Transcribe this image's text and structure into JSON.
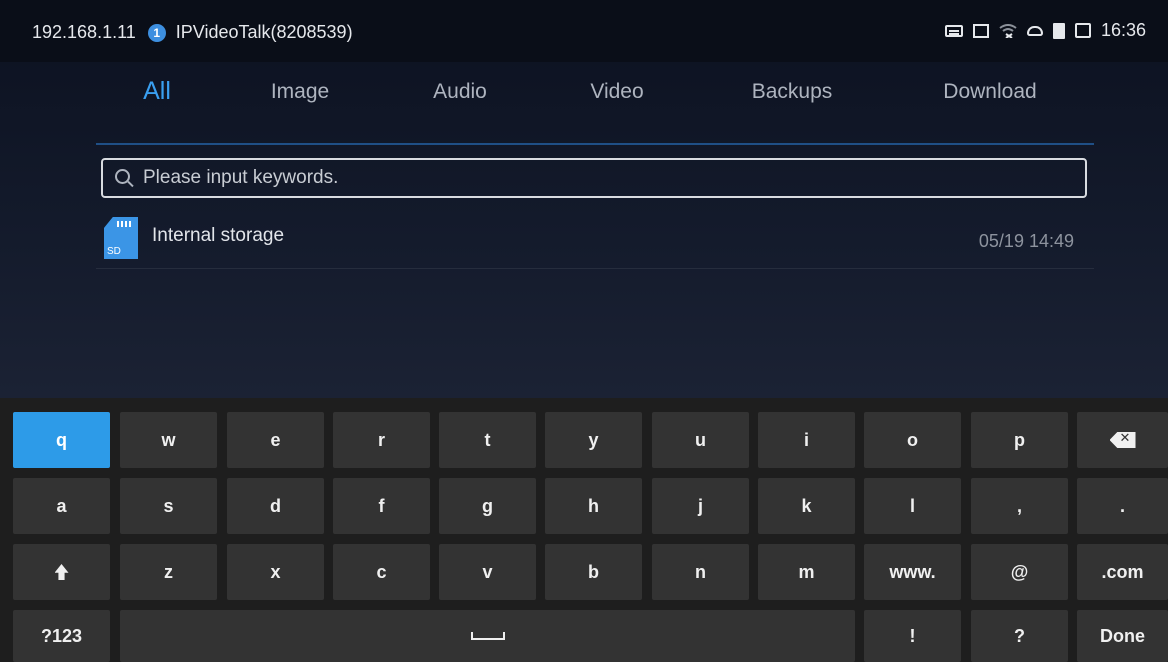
{
  "status_bar": {
    "ip": "192.168.1.11",
    "account": "IPVideoTalk(8208539)",
    "time": "16:36",
    "icons": [
      "keyboard-icon",
      "screen-icon",
      "wifi-icon",
      "cloud-icon",
      "sd-card-icon",
      "message-icon"
    ]
  },
  "tabs": [
    "All",
    "Image",
    "Audio",
    "Video",
    "Backups",
    "Download"
  ],
  "active_tab": "All",
  "search": {
    "placeholder": "Please input keywords."
  },
  "storage": {
    "name": "Internal storage",
    "date": "05/19 14:49",
    "icon_label": "SD"
  },
  "keyboard": {
    "row1": [
      "q",
      "w",
      "e",
      "r",
      "t",
      "y",
      "u",
      "i",
      "o",
      "p"
    ],
    "row2": [
      "a",
      "s",
      "d",
      "f",
      "g",
      "h",
      "j",
      "k",
      "l",
      ",",
      "."
    ],
    "row3": [
      "z",
      "x",
      "c",
      "v",
      "b",
      "n",
      "m",
      "www.",
      "@",
      ".com"
    ],
    "row4": {
      "symbols": "?123",
      "exclaim": "!",
      "question": "?",
      "done": "Done"
    },
    "active_key": "q"
  },
  "colors": {
    "accent": "#3a9ff0",
    "key_bg": "#333333",
    "active_key": "#2d9be8"
  }
}
